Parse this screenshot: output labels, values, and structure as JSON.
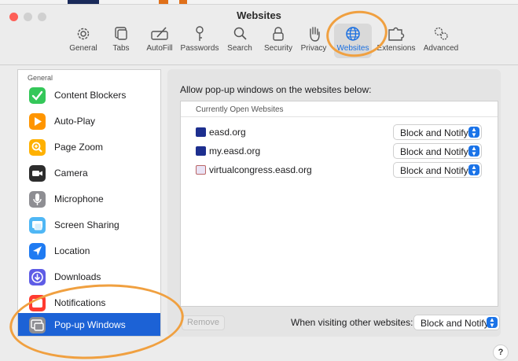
{
  "window": {
    "title": "Websites"
  },
  "toolbar": {
    "items": [
      {
        "label": "General",
        "icon": "gear-icon"
      },
      {
        "label": "Tabs",
        "icon": "tabs-icon"
      },
      {
        "label": "AutoFill",
        "icon": "pencil-icon"
      },
      {
        "label": "Passwords",
        "icon": "key-icon"
      },
      {
        "label": "Search",
        "icon": "magnifier-icon"
      },
      {
        "label": "Security",
        "icon": "lock-icon"
      },
      {
        "label": "Privacy",
        "icon": "hand-icon"
      },
      {
        "label": "Websites",
        "icon": "globe-icon"
      },
      {
        "label": "Extensions",
        "icon": "puzzle-icon"
      },
      {
        "label": "Advanced",
        "icon": "gears-icon"
      }
    ],
    "active": "Websites"
  },
  "sidebar": {
    "header": "General",
    "items": [
      {
        "label": "Content Blockers",
        "icon": "checkmark-icon",
        "color": "#34c759"
      },
      {
        "label": "Auto-Play",
        "icon": "play-icon",
        "color": "#ff9500"
      },
      {
        "label": "Page Zoom",
        "icon": "zoom-icon",
        "color": "#ffb100"
      },
      {
        "label": "Camera",
        "icon": "camera-icon",
        "color": "#2d2d2d"
      },
      {
        "label": "Microphone",
        "icon": "microphone-icon",
        "color": "#8e8e93"
      },
      {
        "label": "Screen Sharing",
        "icon": "screen-icon",
        "color": "#4fb7f5"
      },
      {
        "label": "Location",
        "icon": "location-arrow-icon",
        "color": "#1f7bf2"
      },
      {
        "label": "Downloads",
        "icon": "download-icon",
        "color": "#5e5ce6"
      },
      {
        "label": "Notifications",
        "icon": "notification-icon",
        "color": "#ff3b30"
      },
      {
        "label": "Pop-up Windows",
        "icon": "popup-window-icon",
        "color": "#8e8e93"
      }
    ],
    "selected": "Pop-up Windows"
  },
  "content": {
    "heading": "Allow pop-up windows on the websites below:",
    "list_header": "Currently Open Websites",
    "rows": [
      {
        "site": "easd.org",
        "setting": "Block and Notify"
      },
      {
        "site": "my.easd.org",
        "setting": "Block and Notify"
      },
      {
        "site": "virtualcongress.easd.org",
        "setting": "Block and Notify"
      }
    ],
    "remove_label": "Remove",
    "other_label": "When visiting other websites:",
    "other_setting": "Block and Notify",
    "help_label": "?"
  },
  "colors": {
    "accent": "#1c62d6",
    "annotation": "#f0a040"
  }
}
